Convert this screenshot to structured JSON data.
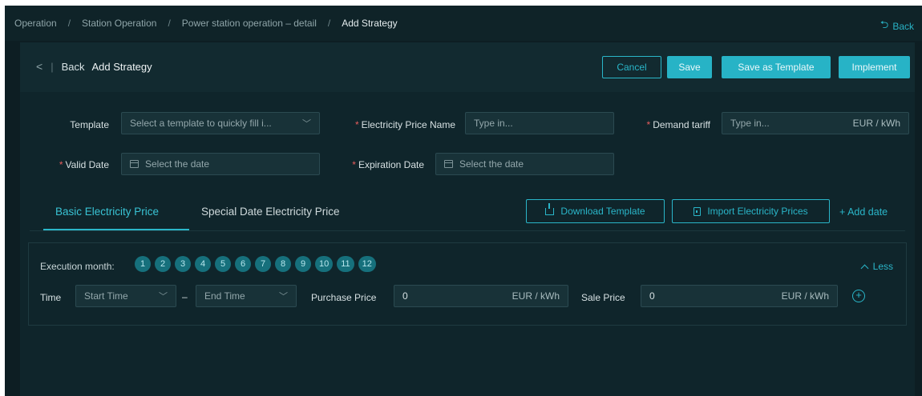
{
  "breadcrumb": {
    "items": [
      "Operation",
      "Station Operation",
      "Power station operation – detail"
    ],
    "separator": "/",
    "current": "Add Strategy",
    "back": "Back"
  },
  "header": {
    "back": "Back",
    "title": "Add Strategy",
    "cancel": "Cancel",
    "save": "Save",
    "save_template": "Save as Template",
    "implement": "Implement"
  },
  "form": {
    "template_label": "Template",
    "template_placeholder": "Select a template to quickly fill i...",
    "price_name_label": "Electricity Price Name",
    "price_name_placeholder": "Type in...",
    "demand_label": "Demand tariff",
    "demand_placeholder": "Type in...",
    "demand_unit": "EUR / kWh",
    "valid_label": "Valid Date",
    "valid_placeholder": "Select the date",
    "expire_label": "Expiration Date",
    "expire_placeholder": "Select the date",
    "required_mark": "*"
  },
  "tabs": {
    "basic": "Basic Electricity Price",
    "special": "Special Date Electricity Price",
    "download": "Download Template",
    "import": "Import Electricity Prices",
    "add_date": "+ Add date"
  },
  "execution": {
    "label": "Execution month:",
    "months": [
      "1",
      "2",
      "3",
      "4",
      "5",
      "6",
      "7",
      "8",
      "9",
      "10",
      "11",
      "12"
    ],
    "less": "Less",
    "time_label": "Time",
    "start_time": "Start Time",
    "dash": "–",
    "end_time": "End Time",
    "purchase_label": "Purchase Price",
    "purchase_value": "0",
    "purchase_unit": "EUR / kWh",
    "sale_label": "Sale Price",
    "sale_value": "0",
    "sale_unit": "EUR / kWh"
  },
  "colors": {
    "accent": "#2ab6c9",
    "background": "#0d1e23",
    "required": "#e85d5d"
  }
}
